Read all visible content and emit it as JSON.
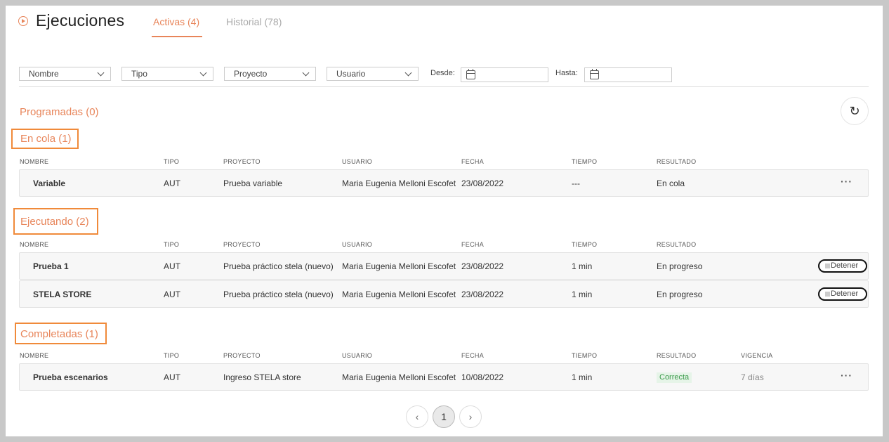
{
  "header": {
    "title": "Ejecuciones",
    "tabs": [
      {
        "label": "Activas (4)",
        "active": true
      },
      {
        "label": "Historial (78)",
        "active": false
      }
    ]
  },
  "filters": {
    "nombre": "Nombre",
    "tipo": "Tipo",
    "proyecto": "Proyecto",
    "usuario": "Usuario",
    "desde_label": "Desde:",
    "hasta_label": "Hasta:",
    "desde_value": "",
    "hasta_value": ""
  },
  "columns": {
    "nombre": "NOMBRE",
    "tipo": "TIPO",
    "proyecto": "PROYECTO",
    "usuario": "USUARIO",
    "fecha": "FECHA",
    "tiempo": "TIEMPO",
    "resultado": "RESULTADO",
    "vigencia": "VIGENCIA"
  },
  "sections": {
    "programadas": {
      "title": "Programadas (0)"
    },
    "en_cola": {
      "title": "En cola (1)",
      "rows": [
        {
          "nombre": "Variable",
          "tipo": "AUT",
          "proyecto": "Prueba variable",
          "usuario": "Maria Eugenia Melloni Escofet",
          "fecha": "23/08/2022",
          "tiempo": "---",
          "resultado": "En cola"
        }
      ]
    },
    "ejecutando": {
      "title": "Ejecutando (2)",
      "action_label": "Detener",
      "rows": [
        {
          "nombre": "Prueba 1",
          "tipo": "AUT",
          "proyecto": "Prueba práctico stela (nuevo)",
          "usuario": "Maria Eugenia Melloni Escofet",
          "fecha": "23/08/2022",
          "tiempo": "1 min",
          "resultado": "En progreso"
        },
        {
          "nombre": "STELA STORE",
          "tipo": "AUT",
          "proyecto": "Prueba práctico stela (nuevo)",
          "usuario": "Maria Eugenia Melloni Escofet",
          "fecha": "23/08/2022",
          "tiempo": "1 min",
          "resultado": "En progreso"
        }
      ]
    },
    "completadas": {
      "title": "Completadas (1)",
      "rows": [
        {
          "nombre": "Prueba escenarios",
          "tipo": "AUT",
          "proyecto": "Ingreso STELA store",
          "usuario": "Maria Eugenia Melloni Escofet",
          "fecha": "10/08/2022",
          "tiempo": "1 min",
          "resultado": "Correcta",
          "vigencia": "7 días"
        }
      ]
    }
  },
  "icons": {
    "title": "play-circle-icon",
    "refresh": "refresh-icon",
    "refresh_glyph": "↻",
    "row_menu_glyph": "···",
    "prev_glyph": "‹",
    "next_glyph": "›"
  },
  "pagination": {
    "current": "1"
  },
  "colors": {
    "accent": "#e8855a",
    "highlight_border": "#f08a3a",
    "success_bg": "#e6f4e8",
    "success_text": "#3a9a4a"
  }
}
